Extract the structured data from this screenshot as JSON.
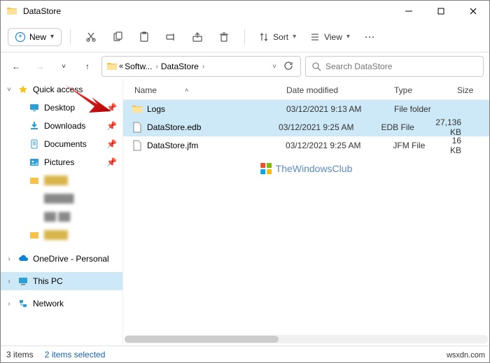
{
  "title": "DataStore",
  "toolbar": {
    "new_label": "New",
    "sort_label": "Sort",
    "view_label": "View"
  },
  "breadcrumb": {
    "seg1": "Softw...",
    "seg2": "DataStore"
  },
  "search": {
    "placeholder": "Search DataStore"
  },
  "columns": {
    "name": "Name",
    "date": "Date modified",
    "type": "Type",
    "size": "Size"
  },
  "sidebar": {
    "quick_access": "Quick access",
    "items": [
      {
        "label": "Desktop"
      },
      {
        "label": "Downloads"
      },
      {
        "label": "Documents"
      },
      {
        "label": "Pictures"
      }
    ],
    "onedrive": "OneDrive - Personal",
    "thispc": "This PC",
    "network": "Network"
  },
  "files": [
    {
      "name": "Logs",
      "date": "03/12/2021 9:13 AM",
      "type": "File folder",
      "size": ""
    },
    {
      "name": "DataStore.edb",
      "date": "03/12/2021 9:25 AM",
      "type": "EDB File",
      "size": "27,136 KB"
    },
    {
      "name": "DataStore.jfm",
      "date": "03/12/2021 9:25 AM",
      "type": "JFM File",
      "size": "16 KB"
    }
  ],
  "status": {
    "count": "3 items",
    "selected": "2 items selected"
  },
  "watermark": "TheWindowsClub",
  "attribution": "wsxdn.com"
}
